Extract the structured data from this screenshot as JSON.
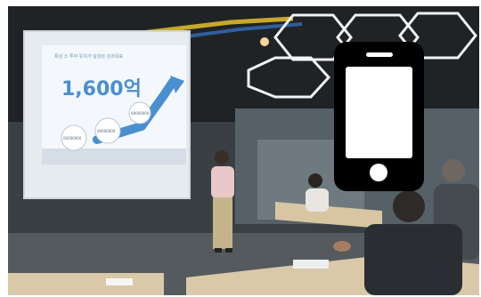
{
  "slide": {
    "headline": "1,600억",
    "small_heading": "특성 스 투자 유치가 달성된 성과목표",
    "label_left": "00000000",
    "label_mid": "00000000",
    "label_right": "00000000"
  },
  "overlay": {
    "icon": "smartphone-icon"
  },
  "colors": {
    "room_dark": "#2a2d30",
    "screen": "#e6ebf0",
    "slide_accent": "#4a8fd0",
    "phone": "#000000"
  }
}
